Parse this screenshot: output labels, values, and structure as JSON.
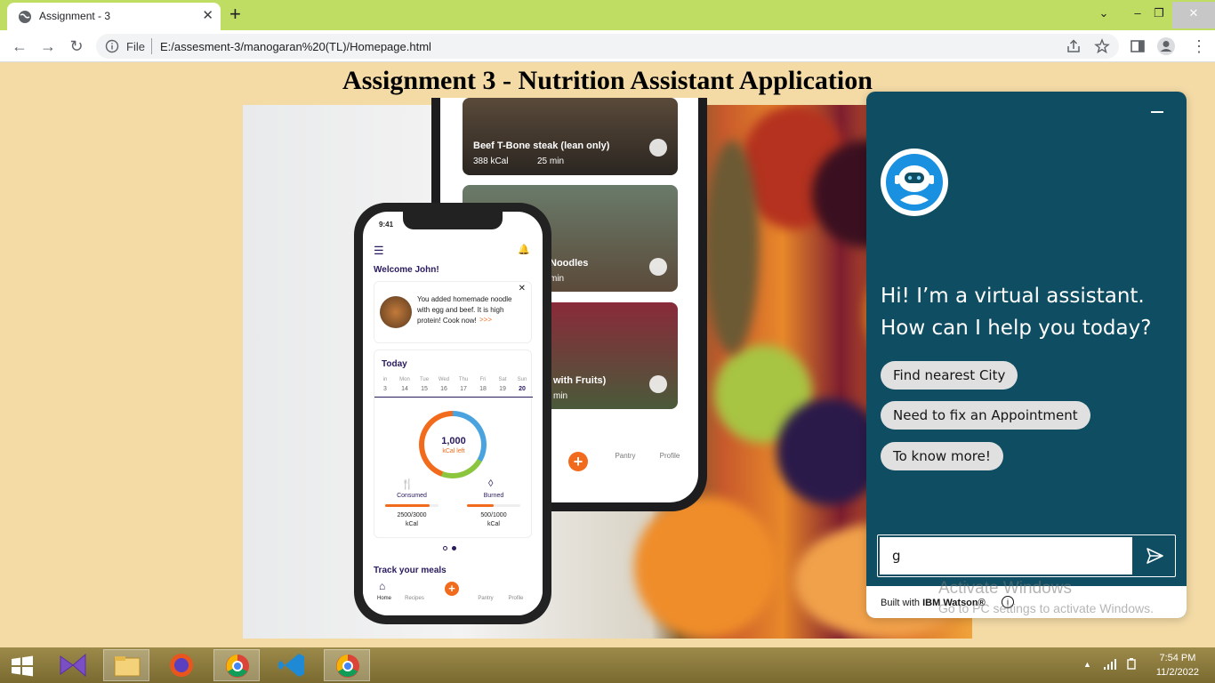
{
  "browser": {
    "tab_title": "Assignment - 3",
    "address_scheme": "File",
    "url": "E:/assesment-3/manogaran%20(TL)/Homepage.html"
  },
  "page": {
    "title": "Assignment 3 - Nutrition Assistant Application"
  },
  "hero": {
    "back_phone": {
      "cards": [
        {
          "name": "Beef T-Bone steak (lean only)",
          "kcal": "388 kCal",
          "time": "25 min"
        },
        {
          "name": "Noodles",
          "time": "min"
        },
        {
          "name": "with Fruits)",
          "time": "min"
        }
      ],
      "nav": [
        "Pantry",
        "Profile"
      ]
    },
    "front_phone": {
      "status_time": "9:41",
      "welcome": "Welcome John!",
      "notice": "You added homemade noodle with egg and beef. It is high protein! Cook now!",
      "notice_link": ">>>",
      "today_label": "Today",
      "days": [
        "in",
        "Mon",
        "Tue",
        "Wed",
        "Thu",
        "Fri",
        "Sat",
        "Sun"
      ],
      "dates": [
        "3",
        "14",
        "15",
        "16",
        "17",
        "18",
        "19",
        "20"
      ],
      "kcal_left_value": "1,000",
      "kcal_left_label": "kCal left",
      "consumed_label": "Consumed",
      "consumed_value": "2500/3000",
      "consumed_unit": "kCal",
      "consumed_fraction": 0.83,
      "burned_label": "Burned",
      "burned_value": "500/1000",
      "burned_unit": "kCal",
      "burned_fraction": 0.5,
      "track_label": "Track your meals",
      "nav": [
        "Home",
        "Recipes",
        "Pantry",
        "Profile"
      ]
    }
  },
  "chat": {
    "greeting": "Hi! I’m a virtual assistant. How can I help you today?",
    "options": [
      "Find nearest City",
      "Need to fix an Appointment",
      "To know more!"
    ],
    "input_value": "g",
    "built_with": "Built with",
    "brand": "IBM Watson®"
  },
  "watermark": {
    "line1": "Activate Windows",
    "line2": "Go to PC settings to activate Windows."
  },
  "taskbar": {
    "time": "7:54 PM",
    "date": "11/2/2022"
  }
}
